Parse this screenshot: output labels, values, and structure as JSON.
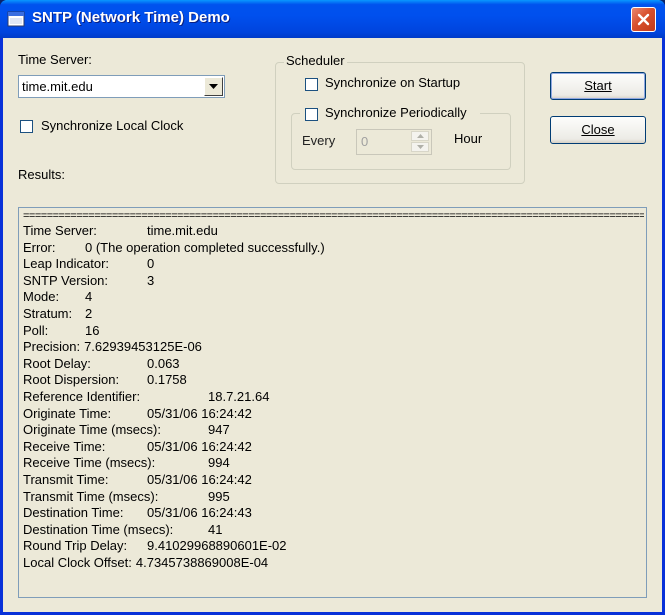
{
  "window": {
    "title": "SNTP (Network Time) Demo"
  },
  "time_server": {
    "label": "Time Server:",
    "value": "time.mit.edu"
  },
  "sync_local_clock": {
    "label": "Synchronize Local Clock",
    "checked": false
  },
  "results_label": "Results:",
  "scheduler": {
    "title": "Scheduler",
    "sync_on_startup": {
      "label": "Synchronize on Startup",
      "checked": false
    },
    "sync_periodically": {
      "label": "Synchronize Periodically",
      "checked": false
    },
    "every_label": "Every",
    "every_value": "0",
    "unit_label": "Hour"
  },
  "buttons": {
    "start": "Start",
    "close": "Close"
  },
  "results": {
    "separator": "==============================================================================================================================",
    "lines": [
      {
        "key": "Time Server:",
        "val": "time.mit.edu"
      },
      {
        "key": "Error:",
        "val": "0 (The operation completed successfully.)"
      },
      {
        "key": "Leap Indicator:",
        "val": "0"
      },
      {
        "key": "SNTP Version:",
        "val": "3"
      },
      {
        "key": "Mode:",
        "val": "4"
      },
      {
        "key": "Stratum:",
        "val": "2"
      },
      {
        "key": "Poll:",
        "val": "16"
      },
      {
        "key": "Precision:",
        "val": "7.62939453125E-06"
      },
      {
        "key": "Root Delay:",
        "val": "0.063"
      },
      {
        "key": "Root Dispersion:",
        "val": "0.1758"
      },
      {
        "key": "Reference Identifier:",
        "val": "18.7.21.64"
      },
      {
        "key": "Originate Time:",
        "val": "05/31/06 16:24:42"
      },
      {
        "key": "Originate Time (msecs):",
        "val": "947"
      },
      {
        "key": "Receive Time:",
        "val": "05/31/06 16:24:42"
      },
      {
        "key": "Receive Time (msecs):",
        "val": "994"
      },
      {
        "key": "Transmit Time:",
        "val": "05/31/06 16:24:42"
      },
      {
        "key": "Transmit Time (msecs):",
        "val": "995"
      },
      {
        "key": "Destination Time:",
        "val": "05/31/06 16:24:43"
      },
      {
        "key": "Destination Time (msecs):",
        "val": "41"
      },
      {
        "key": "Round Trip Delay:",
        "val": "9.41029968890601E-02"
      },
      {
        "key": "Local Clock Offset:",
        "val": "4.7345738869008E-04"
      }
    ]
  }
}
